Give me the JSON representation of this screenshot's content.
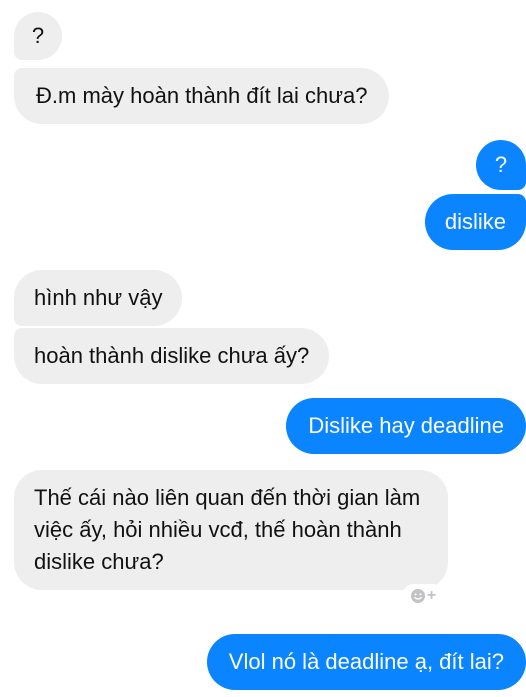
{
  "conversation": {
    "messages": [
      {
        "side": "incoming",
        "text": "?"
      },
      {
        "side": "incoming",
        "text": "Đ.m mày hoàn thành đít lai chưa?"
      },
      {
        "side": "outgoing",
        "text": "?"
      },
      {
        "side": "outgoing",
        "text": "dislike"
      },
      {
        "side": "incoming",
        "text": "hình như vậy"
      },
      {
        "side": "incoming",
        "text": "hoàn thành dislike chưa ấy?"
      },
      {
        "side": "outgoing",
        "text": "Dislike hay deadline"
      },
      {
        "side": "incoming",
        "text": "Thế cái nào liên quan đến thời gian làm việc ấy, hỏi nhiều vcđ, thế hoàn thành dislike chưa?"
      },
      {
        "side": "outgoing",
        "text": "Vlol nó là deadline ạ, đít lai?"
      }
    ]
  },
  "colors": {
    "incoming_bubble": "#eeeeef",
    "outgoing_bubble": "#0a84ff",
    "reaction_icon": "#c3c3c7"
  },
  "icons": {
    "reaction": "add-reaction-icon"
  }
}
